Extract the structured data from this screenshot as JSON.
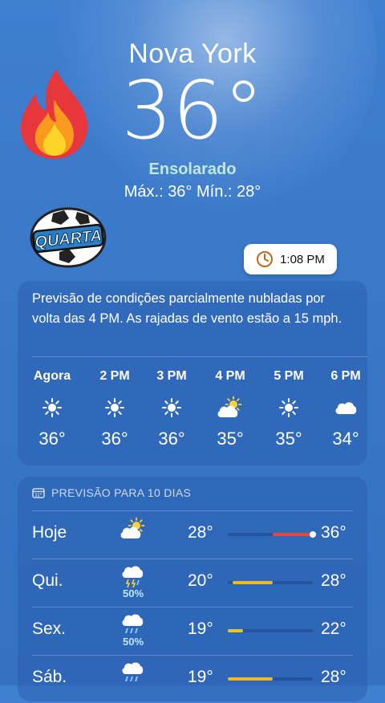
{
  "location": {
    "city": "Nova York",
    "temperature": "36°",
    "condition": "Ensolarado",
    "hilo": "Máx.: 36°  Mín.: 28°"
  },
  "sticker": {
    "text": "QUARTA"
  },
  "time_badge": {
    "time": "1:08 PM",
    "icon": "clock-icon"
  },
  "hourly": {
    "summary": "Previsão de condições parcialmente nubladas por volta das 4 PM. As rajadas de vento estão a 15 mph.",
    "items": [
      {
        "label": "Agora",
        "icon": "sun-icon",
        "temp": "36°"
      },
      {
        "label": "2 PM",
        "icon": "sun-icon",
        "temp": "36°"
      },
      {
        "label": "3 PM",
        "icon": "sun-icon",
        "temp": "36°"
      },
      {
        "label": "4 PM",
        "icon": "partly-cloudy-icon",
        "temp": "35°"
      },
      {
        "label": "5 PM",
        "icon": "sun-icon",
        "temp": "35°"
      },
      {
        "label": "6 PM",
        "icon": "cloud-icon",
        "temp": "34°"
      }
    ]
  },
  "daily": {
    "header": "PREVISÃO PARA 10 DIAS",
    "range_low": 19,
    "range_high": 36,
    "rows": [
      {
        "day": "Hoje",
        "icon": "partly-cloudy-icon",
        "precip": "",
        "low": "28°",
        "high": "36°",
        "low_val": 28,
        "high_val": 36,
        "color": "#e8453c",
        "current": 36
      },
      {
        "day": "Qui.",
        "icon": "thunderstorm-icon",
        "precip": "50%",
        "low": "20°",
        "high": "28°",
        "low_val": 20,
        "high_val": 28,
        "color": "#f2b824"
      },
      {
        "day": "Sex.",
        "icon": "rain-icon",
        "precip": "50%",
        "low": "19°",
        "high": "22°",
        "low_val": 19,
        "high_val": 22,
        "color": "#e8c62a"
      },
      {
        "day": "Sáb.",
        "icon": "rain-icon",
        "precip": "",
        "low": "19°",
        "high": "28°",
        "low_val": 19,
        "high_val": 28,
        "color": "#f2b824"
      }
    ]
  }
}
